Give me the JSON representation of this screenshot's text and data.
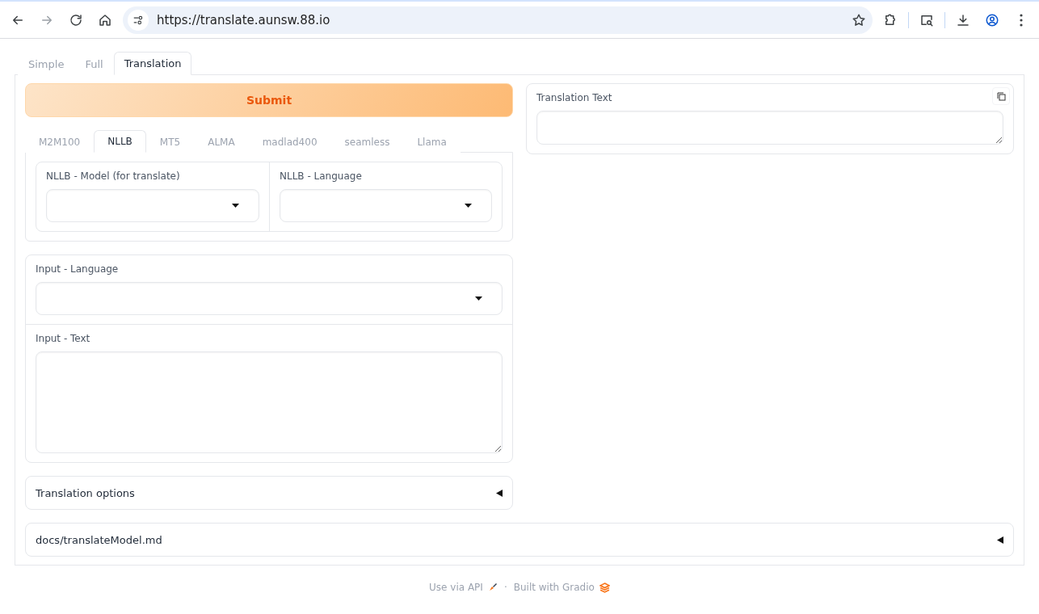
{
  "browser": {
    "url": "https://translate.aunsw.88.io"
  },
  "tabs": [
    {
      "label": "Simple",
      "selected": false
    },
    {
      "label": "Full",
      "selected": false
    },
    {
      "label": "Translation",
      "selected": true
    }
  ],
  "submit": "Submit",
  "model_tabs": [
    {
      "label": "M2M100",
      "selected": false
    },
    {
      "label": "NLLB",
      "selected": true
    },
    {
      "label": "MT5",
      "selected": false
    },
    {
      "label": "ALMA",
      "selected": false
    },
    {
      "label": "madlad400",
      "selected": false
    },
    {
      "label": "seamless",
      "selected": false
    },
    {
      "label": "Llama",
      "selected": false
    }
  ],
  "nllb_model": {
    "label": "NLLB - Model (for translate)"
  },
  "nllb_language": {
    "label": "NLLB - Language"
  },
  "input_language": {
    "label": "Input - Language"
  },
  "input_text": {
    "label": "Input - Text"
  },
  "translation_options": {
    "label": "Translation options",
    "expanded": false
  },
  "translation_text": {
    "label": "Translation Text"
  },
  "docs": {
    "label": "docs/translateModel.md",
    "expanded": false
  },
  "footer": {
    "api": "Use via API",
    "separator": "·",
    "built": "Built with Gradio"
  }
}
